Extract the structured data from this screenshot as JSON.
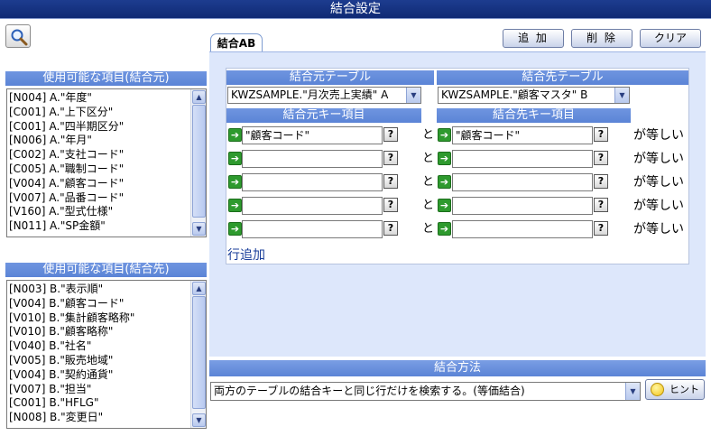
{
  "title": "結合設定",
  "toolbar": {
    "add_label": "追 加",
    "delete_label": "削 除",
    "clear_label": "クリア"
  },
  "tab": {
    "label": "結合AB"
  },
  "left": {
    "source_header": "使用可能な項目(結合元)",
    "source_items": [
      "[N004] A.\"年度\"",
      "[C001] A.\"上下区分\"",
      "[C001] A.\"四半期区分\"",
      "[N006] A.\"年月\"",
      "[C002] A.\"支社コード\"",
      "[C005] A.\"職制コード\"",
      "[V004] A.\"顧客コード\"",
      "[V007] A.\"品番コード\"",
      "[V160] A.\"型式仕様\"",
      "[N011] A.\"SP金額\""
    ],
    "target_header": "使用可能な項目(結合先)",
    "target_items": [
      "[N003] B.\"表示順\"",
      "[V004] B.\"顧客コード\"",
      "[V010] B.\"集計顧客略称\"",
      "[V010] B.\"顧客略称\"",
      "[V040] B.\"社名\"",
      "[V005] B.\"販売地域\"",
      "[V004] B.\"契約通貨\"",
      "[V007] B.\"担当\"",
      "[C001] B.\"HFLG\"",
      "[N008] B.\"変更日\""
    ]
  },
  "join": {
    "source_table_header": "結合元テーブル",
    "target_table_header": "結合先テーブル",
    "source_table_value": "KWZSAMPLE.\"月次売上実績\" A",
    "target_table_value": "KWZSAMPLE.\"顧客マスタ\" B",
    "source_key_header": "結合元キー項目",
    "target_key_header": "結合先キー項目",
    "connector": "と",
    "equals": "が等しい",
    "rows": [
      {
        "source_key": "\"顧客コード\"",
        "target_key": "\"顧客コード\""
      },
      {
        "source_key": "",
        "target_key": ""
      },
      {
        "source_key": "",
        "target_key": ""
      },
      {
        "source_key": "",
        "target_key": ""
      },
      {
        "source_key": "",
        "target_key": ""
      }
    ],
    "add_row_label": "行追加",
    "help_symbol": "?"
  },
  "method": {
    "header": "結合方法",
    "value": "両方のテーブルの結合キーと同じ行だけを検索する。(等価結合)",
    "hint_label": "ヒント"
  },
  "icons": {
    "search": "search-icon",
    "arrow": "right-arrow-icon",
    "bulb": "lightbulb-icon"
  }
}
